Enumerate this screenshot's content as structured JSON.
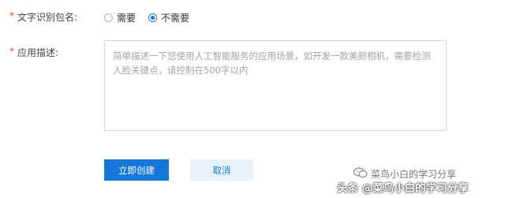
{
  "form": {
    "package_name": {
      "required_mark": "*",
      "label": "文字识别包名:",
      "options": [
        {
          "label": "需要",
          "checked": false
        },
        {
          "label": "不需要",
          "checked": true
        }
      ]
    },
    "description": {
      "required_mark": "*",
      "label": "应用描述:",
      "value": "",
      "placeholder": "简单描述一下您使用人工智能服务的应用场景，如开发一款美颜相机，需要检测人脸关键点，请控制在500字以内"
    }
  },
  "actions": {
    "create_label": "立即创建",
    "cancel_label": "取消"
  },
  "watermark": {
    "line1": "菜鸟小白的学习分享",
    "line2": "头条 @菜鸟小白的学习分享",
    "icon": "wechat-icon"
  },
  "colors": {
    "primary": "#1677d9",
    "required": "#e8453c"
  }
}
